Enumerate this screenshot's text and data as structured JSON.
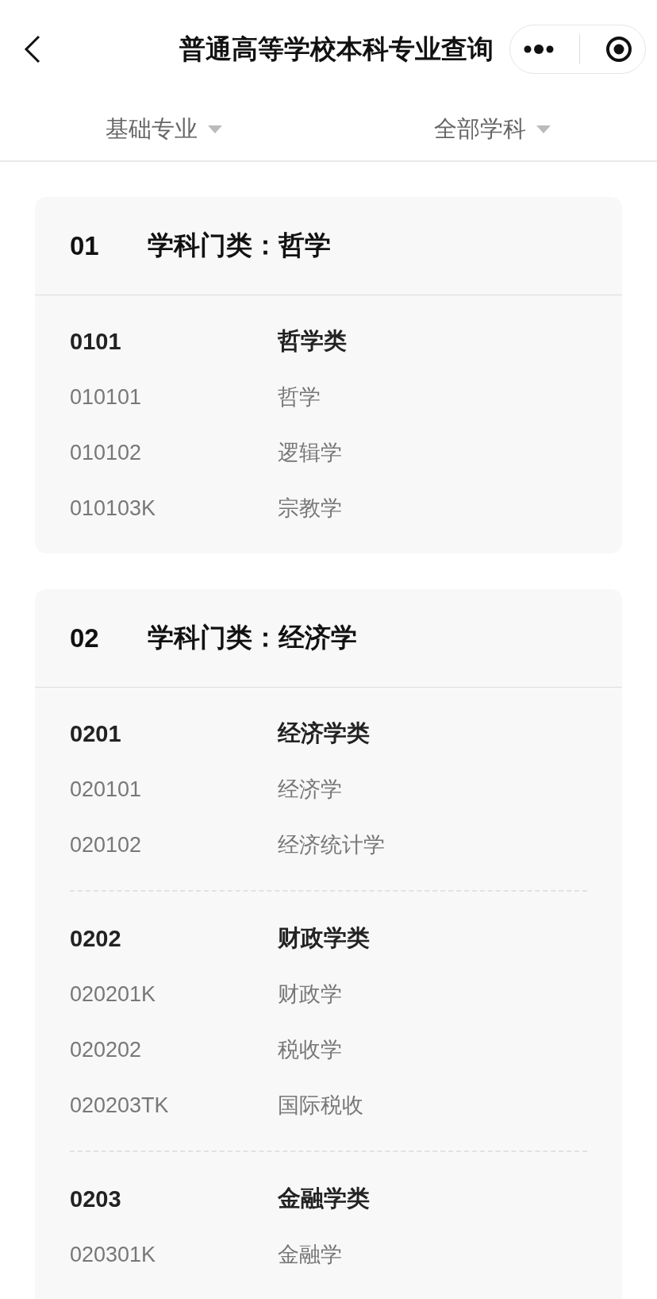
{
  "nav": {
    "title": "普通高等学校本科专业查询"
  },
  "filters": [
    {
      "label": "基础专业"
    },
    {
      "label": "全部学科"
    }
  ],
  "categories": [
    {
      "code": "01",
      "title": "学科门类：哲学",
      "groups": [
        {
          "code": "0101",
          "name": "哲学类",
          "majors": [
            {
              "code": "010101",
              "name": "哲学"
            },
            {
              "code": "010102",
              "name": "逻辑学"
            },
            {
              "code": "010103K",
              "name": "宗教学"
            }
          ]
        }
      ]
    },
    {
      "code": "02",
      "title": "学科门类：经济学",
      "groups": [
        {
          "code": "0201",
          "name": "经济学类",
          "majors": [
            {
              "code": "020101",
              "name": "经济学"
            },
            {
              "code": "020102",
              "name": "经济统计学"
            }
          ]
        },
        {
          "code": "0202",
          "name": "财政学类",
          "majors": [
            {
              "code": "020201K",
              "name": "财政学"
            },
            {
              "code": "020202",
              "name": "税收学"
            },
            {
              "code": "020203TK",
              "name": "国际税收"
            }
          ]
        },
        {
          "code": "0203",
          "name": "金融学类",
          "majors": [
            {
              "code": "020301K",
              "name": "金融学"
            }
          ]
        }
      ]
    }
  ]
}
